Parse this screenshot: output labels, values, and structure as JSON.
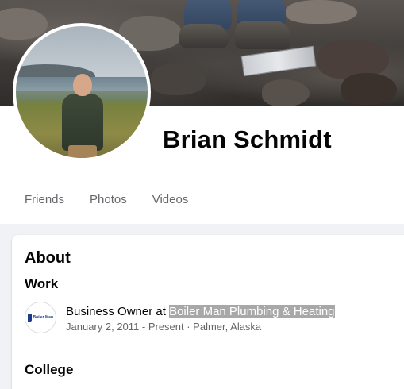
{
  "profile": {
    "name": "Brian Schmidt"
  },
  "tabs": [
    {
      "label": "Friends"
    },
    {
      "label": "Photos"
    },
    {
      "label": "Videos"
    }
  ],
  "about": {
    "title": "About",
    "work": {
      "heading": "Work",
      "prefix": "Business Owner at ",
      "company": "Boiler Man Plumbing & Heating",
      "details": "January 2, 2011 - Present · Palmer, Alaska",
      "logo_text": "Boiler Man"
    },
    "college": {
      "heading": "College"
    }
  },
  "colors": {
    "text_primary": "#050505",
    "text_secondary": "#65676b",
    "divider": "#ced0d4",
    "highlight": "#a8a8a8",
    "background": "#f0f2f5"
  }
}
